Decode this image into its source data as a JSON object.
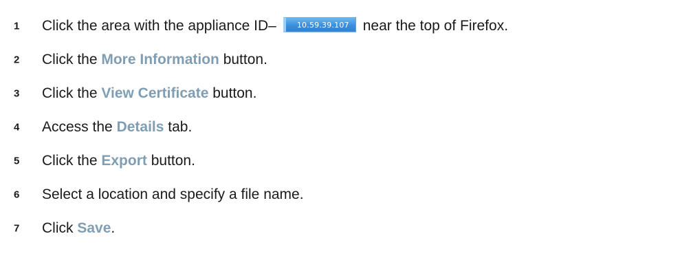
{
  "steps": [
    {
      "number": "1",
      "before": "Click the area with the appliance ID–",
      "badge": "10.59.39.107",
      "after": "near the top of Firefox."
    },
    {
      "number": "2",
      "before": "Click the ",
      "highlight": "More Information",
      "after": " button."
    },
    {
      "number": "3",
      "before": "Click the ",
      "highlight": "View Certificate",
      "after": " button."
    },
    {
      "number": "4",
      "before": "Access the ",
      "highlight": "Details",
      "after": " tab."
    },
    {
      "number": "5",
      "before": "Click the ",
      "highlight": "Export",
      "after": " button."
    },
    {
      "number": "6",
      "text": "Select a location and specify a file name."
    },
    {
      "number": "7",
      "before": "Click ",
      "highlight": "Save",
      "after": "."
    }
  ],
  "colors": {
    "highlight": "#7f9db3",
    "badge_bg": "#3b8fdc",
    "text": "#1a1a1a"
  }
}
